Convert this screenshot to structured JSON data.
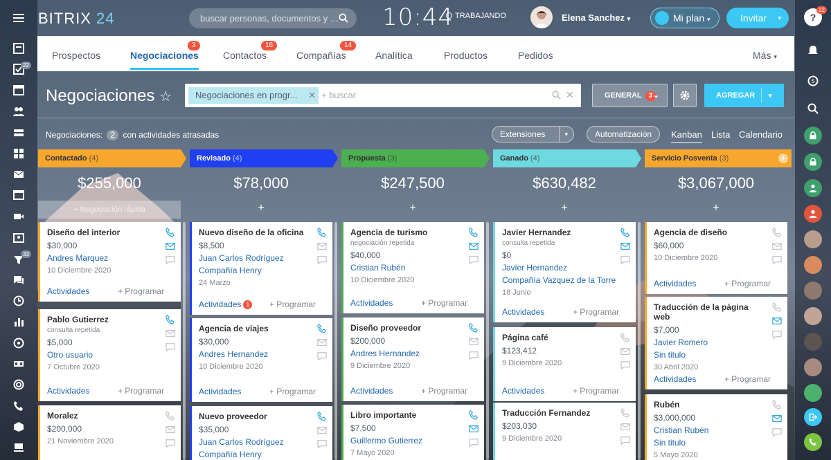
{
  "brand": {
    "name": "BITRIX",
    "num": "24"
  },
  "header": {
    "search_placeholder": "buscar personas, documentos y ...",
    "time": "10:44",
    "status": "TRABAJANDO",
    "user": "Elena Sanchez",
    "plan": "Mi plan",
    "invite": "Invitar"
  },
  "tabs": [
    {
      "label": "Prospectos"
    },
    {
      "label": "Negociaciones",
      "badge": "3"
    },
    {
      "label": "Contactos",
      "badge": "16"
    },
    {
      "label": "Compañías",
      "badge": "14"
    },
    {
      "label": "Analítica"
    },
    {
      "label": "Productos"
    },
    {
      "label": "Pedidos"
    },
    {
      "label": "Más"
    }
  ],
  "page": {
    "title": "Negociaciones",
    "filter_chip": "Negociaciones en progr...",
    "filter_placeholder": "+ buscar",
    "general": "GENERAL",
    "general_badge": "3",
    "add": "AGREGAR",
    "late_prefix": "Negociaciones:",
    "late_count": "2",
    "late_suffix": "con actividades atrasadas",
    "extensions": "Extensiones",
    "automation": "Automatización",
    "views": [
      "Kanban",
      "Lista",
      "Calendario"
    ]
  },
  "left_counts": {
    "tasks": "22",
    "feed": "33"
  },
  "right_counts": {
    "help": "22"
  },
  "labels": {
    "activities": "Actividades",
    "schedule": "+ Programar",
    "quick": "Negociación rápida"
  },
  "columns": [
    {
      "name": "Contactado",
      "count": "(4)",
      "total": "$255,000",
      "color": "#f8a72e",
      "cards": [
        {
          "title": "Diseño del interior",
          "price": "$30,000",
          "links": [
            "Andres Marquez"
          ],
          "date": "10 Diciembre 2020"
        },
        {
          "title": "Pablo Gutierrez",
          "sub": "consulta repetida",
          "price": "$5,000",
          "links": [
            "Otro usuario"
          ],
          "date": "7 Octubre 2020"
        },
        {
          "title": "Moralez",
          "price": "$200,000",
          "links": [],
          "date": "21 Noviembre 2020"
        }
      ]
    },
    {
      "name": "Revisado",
      "count": "(4)",
      "total": "$78,000",
      "color": "#1f3ff0",
      "cards": [
        {
          "title": "Nuevo diseño de la oficina",
          "price": "$8,500",
          "links": [
            "Juan Carlos Rodríguez",
            "Compañía Henry"
          ],
          "date": "24 Marzo",
          "act_badge": "1"
        },
        {
          "title": "Agencia de viajes",
          "price": "$30,000",
          "links": [
            "Andres Hernandez"
          ],
          "date": "10 Diciembre 2020"
        },
        {
          "title": "Nuevo proveedor",
          "price": "$35,000",
          "links": [
            "Juan Carlos Rodríguez",
            "Compañía Henry"
          ],
          "date": ""
        }
      ]
    },
    {
      "name": "Propuesta",
      "count": "(3)",
      "total": "$247,500",
      "color": "#4caf50",
      "cards": [
        {
          "title": "Agencia de turismo",
          "sub": "negociación repetida",
          "price": "$40,000",
          "links": [
            "Cristian Rubén"
          ],
          "date": "10 Diciembre 2020"
        },
        {
          "title": "Diseño proveedor",
          "price": "$200,000",
          "links": [
            "Andres Hernandez"
          ],
          "date": "9 Diciembre 2020"
        },
        {
          "title": "Libro importante",
          "price": "$7,500",
          "links": [
            "Guillermo Gutierrez"
          ],
          "date": "7 Mayo 2020"
        }
      ]
    },
    {
      "name": "Ganado",
      "count": "(4)",
      "total": "$630,482",
      "color": "#6fd9e0",
      "cards": [
        {
          "title": "Javier Hernandez",
          "sub": "consulta repetida",
          "price": "$0",
          "links": [
            "Javier Hernandez",
            "Compañía Vazquez de la Torre"
          ],
          "date": "18 Junio"
        },
        {
          "title": "Página café",
          "price": "$123,412",
          "links": [],
          "date": "9 Diciembre 2020"
        },
        {
          "title": "Traducción Fernandez",
          "price": "$203,030",
          "links": [],
          "date": "9 Diciembre 2020"
        }
      ]
    },
    {
      "name": "Servicio Posventa",
      "count": "(3)",
      "total": "$3,067,000",
      "color": "#f8a72e",
      "cards": [
        {
          "title": "Agencia de diseño",
          "price": "$60,000",
          "links": [],
          "date": "10 Diciembre 2020"
        },
        {
          "title": "Traducción de la página web",
          "price": "$7,000",
          "links": [
            "Javier Romero",
            "Sin titulo"
          ],
          "date": "30 Abril 2020"
        },
        {
          "title": "Rubén",
          "price": "$3,000,000",
          "links": [
            "Cristian Rubén",
            "Sin titulo"
          ],
          "date": "5 Mayo 2020"
        }
      ]
    }
  ]
}
